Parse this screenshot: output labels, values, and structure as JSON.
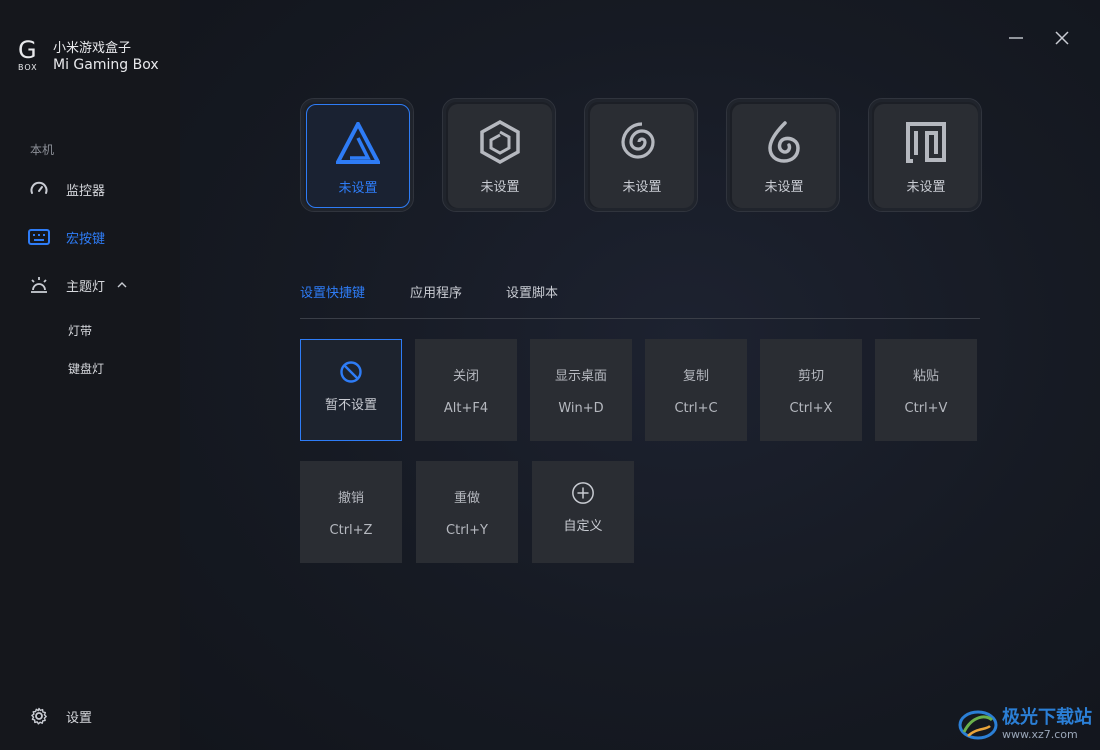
{
  "brand": {
    "logo_g": "G",
    "logo_box": "BOX",
    "name_cn": "小米游戏盒子",
    "name_en": "Mi Gaming Box"
  },
  "sidebar": {
    "section": "本机",
    "items": [
      {
        "label": "监控器",
        "icon": "speedometer-icon"
      },
      {
        "label": "宏按键",
        "icon": "keyboard-icon",
        "active": true
      },
      {
        "label": "主题灯",
        "icon": "lamp-icon",
        "expanded": true
      }
    ],
    "sub_items": [
      {
        "label": "灯带"
      },
      {
        "label": "键盘灯"
      }
    ],
    "settings_label": "设置"
  },
  "profiles": [
    {
      "label": "未设置",
      "icon": "triangle-logo-icon",
      "active": true
    },
    {
      "label": "未设置",
      "icon": "hexagon-logo-icon"
    },
    {
      "label": "未设置",
      "icon": "spiral-icon"
    },
    {
      "label": "未设置",
      "icon": "flame-icon"
    },
    {
      "label": "未设置",
      "icon": "square-spiral-icon"
    }
  ],
  "tabs": [
    {
      "label": "设置快捷键",
      "active": true
    },
    {
      "label": "应用程序"
    },
    {
      "label": "设置脚本"
    }
  ],
  "shortcuts": [
    {
      "label": "暂不设置",
      "icon": "ban-icon",
      "active": true
    },
    {
      "name": "关闭",
      "key": "Alt+F4"
    },
    {
      "name": "显示桌面",
      "key": "Win+D"
    },
    {
      "name": "复制",
      "key": "Ctrl+C"
    },
    {
      "name": "剪切",
      "key": "Ctrl+X"
    },
    {
      "name": "粘贴",
      "key": "Ctrl+V"
    },
    {
      "name": "撤销",
      "key": "Ctrl+Z"
    },
    {
      "name": "重做",
      "key": "Ctrl+Y"
    },
    {
      "label": "自定义",
      "icon": "plus-circle-icon"
    }
  ],
  "watermark": {
    "name": "极光下载站",
    "url": "www.xz7.com"
  },
  "colors": {
    "accent": "#2e7cf6",
    "sidebar_bg": "#15171c",
    "tile_bg": "#2a2d33"
  }
}
